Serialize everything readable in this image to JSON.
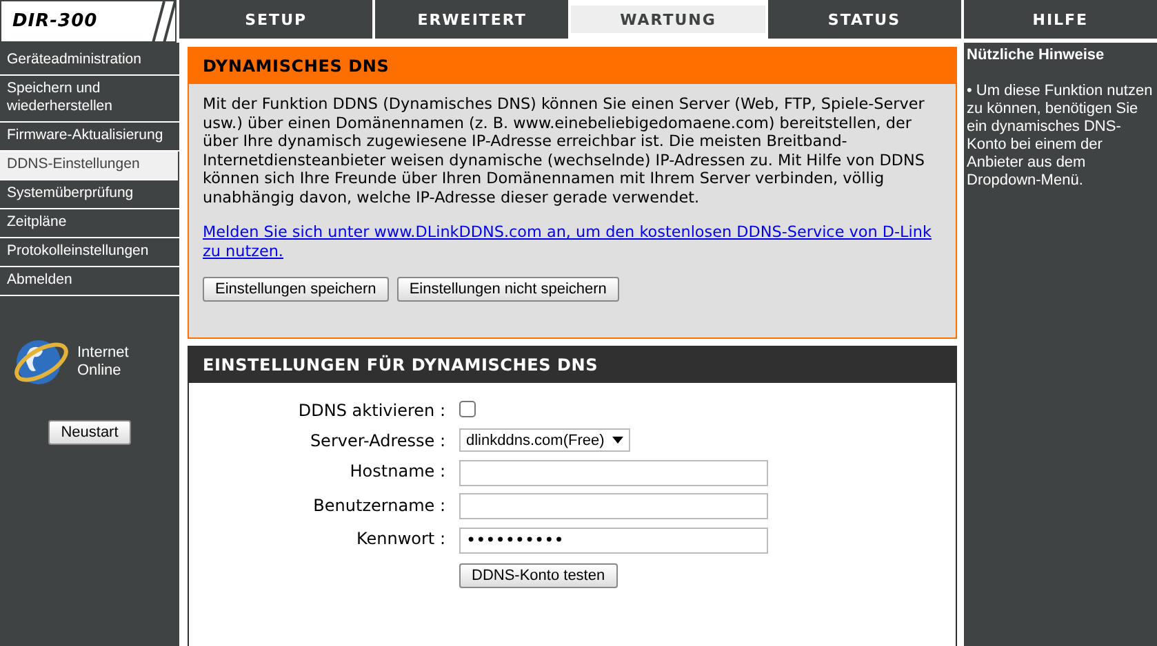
{
  "logo": "DIR-300",
  "tabs": [
    {
      "label": "SETUP",
      "selected": false
    },
    {
      "label": "ERWEITERT",
      "selected": false
    },
    {
      "label": "WARTUNG",
      "selected": true
    },
    {
      "label": "STATUS",
      "selected": false
    },
    {
      "label": "HILFE",
      "selected": false
    }
  ],
  "sidebar": {
    "items": [
      {
        "label": "Geräteadministration",
        "selected": false
      },
      {
        "label": "Speichern und wiederherstellen",
        "selected": false
      },
      {
        "label": "Firmware-Aktualisierung",
        "selected": false
      },
      {
        "label": "DDNS-Einstellungen",
        "selected": true
      },
      {
        "label": "Systemüberprüfung",
        "selected": false
      },
      {
        "label": "Zeitpläne",
        "selected": false
      },
      {
        "label": "Protokolleinstellungen",
        "selected": false
      },
      {
        "label": "Abmelden",
        "selected": false
      }
    ],
    "status_lines": [
      "Internet",
      "Online"
    ],
    "reboot_button": "Neustart"
  },
  "intro": {
    "title": "DYNAMISCHES DNS",
    "paragraph": "Mit der Funktion DDNS (Dynamisches DNS) können Sie einen Server (Web, FTP, Spiele-Server usw.) über einen Domänennamen (z. B. www.einebeliebigedomaene.com) bereitstellen, der über Ihre dynamisch zugewiesene IP-Adresse erreichbar ist. Die meisten Breitband-Internetdiensteanbieter weisen dynamische (wechselnde) IP-Adressen zu. Mit Hilfe von DDNS können sich Ihre Freunde über Ihren Domänennamen mit Ihrem Server verbinden, völlig unabhängig davon, welche IP-Adresse dieser gerade verwendet.",
    "link": "Melden Sie sich unter www.DLinkDDNS.com an, um den kostenlosen DDNS-Service von D-Link zu nutzen.",
    "buttons": [
      "Einstellungen speichern",
      "Einstellungen nicht speichern"
    ]
  },
  "settings": {
    "title": "EINSTELLUNGEN FÜR DYNAMISCHES DNS",
    "fields": [
      {
        "kind": "checkbox",
        "label": "DDNS aktivieren :",
        "checked": false
      },
      {
        "kind": "select",
        "label": "Server-Adresse :",
        "value": "dlinkddns.com(Free)"
      },
      {
        "kind": "text",
        "label": "Hostname :"
      },
      {
        "kind": "text",
        "label": "Benutzername :"
      },
      {
        "kind": "text",
        "label": "Kennwort :",
        "value": "••••••••••"
      }
    ],
    "test_button": "DDNS-Konto testen"
  },
  "help": {
    "title": "Nützliche Hinweise",
    "tip": "• Um diese Funktion nutzen zu können, benötigen Sie ein dynamisches DNS-Konto bei einem der Anbieter aus dem Dropdown-Menü."
  }
}
